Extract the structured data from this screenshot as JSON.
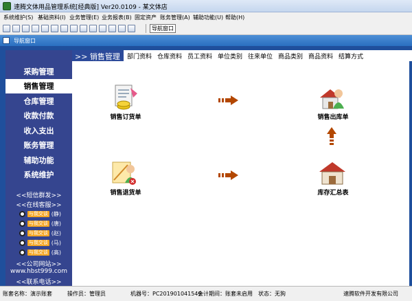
{
  "window": {
    "title": "速腾文体用品管理系统[经典版] Ver20.0109 - 某文体店"
  },
  "menu": [
    "系统维护(S)",
    "基础资料(I)",
    "业务管理(E)",
    "业务报表(B)",
    "固定资产",
    "账务管理(A)",
    "辅助功能(U)",
    "帮助(H)"
  ],
  "toolbar": {
    "nav_button": "导航窗口"
  },
  "nav_window": {
    "title": "导航窗口"
  },
  "sidebar": {
    "items": [
      "采购管理",
      "销售管理",
      "仓库管理",
      "收款付款",
      "收入支出",
      "账务管理",
      "辅助功能",
      "系统维护"
    ],
    "active_index": 1,
    "sms_link": "<<短信群发>>",
    "service_link": "<<在线客服>>",
    "qq": [
      {
        "btn": "与我交谈",
        "name": "(静)"
      },
      {
        "btn": "与我交谈",
        "name": "(唐)"
      },
      {
        "btn": "与我交谈",
        "name": "(赵)"
      },
      {
        "btn": "与我交谈",
        "name": "(马)"
      },
      {
        "btn": "与我交谈",
        "name": "(高)"
      }
    ],
    "company_site": "<<公司网站>>",
    "url": "www.hbst999.com",
    "phone": "<<联系电话>>"
  },
  "header": {
    "title": ">> 销售管理",
    "tabs": [
      "部门资料",
      "仓库资料",
      "员工资料",
      "单位类别",
      "往来单位",
      "商品类别",
      "商品资料",
      "结算方式"
    ]
  },
  "functions": {
    "sales_order": "销售订货单",
    "sales_outbound": "销售出库单",
    "sales_return": "销售退货单",
    "inventory_summary": "库存汇总表"
  },
  "status": {
    "account": "账套名称：演示账套",
    "operator": "操作员：管理员",
    "machine": "机器号：PC201901041549",
    "period": "会计期间：账套未启用",
    "state": "状态：无狗",
    "company_tail": "速腾软件开发有限公司"
  }
}
